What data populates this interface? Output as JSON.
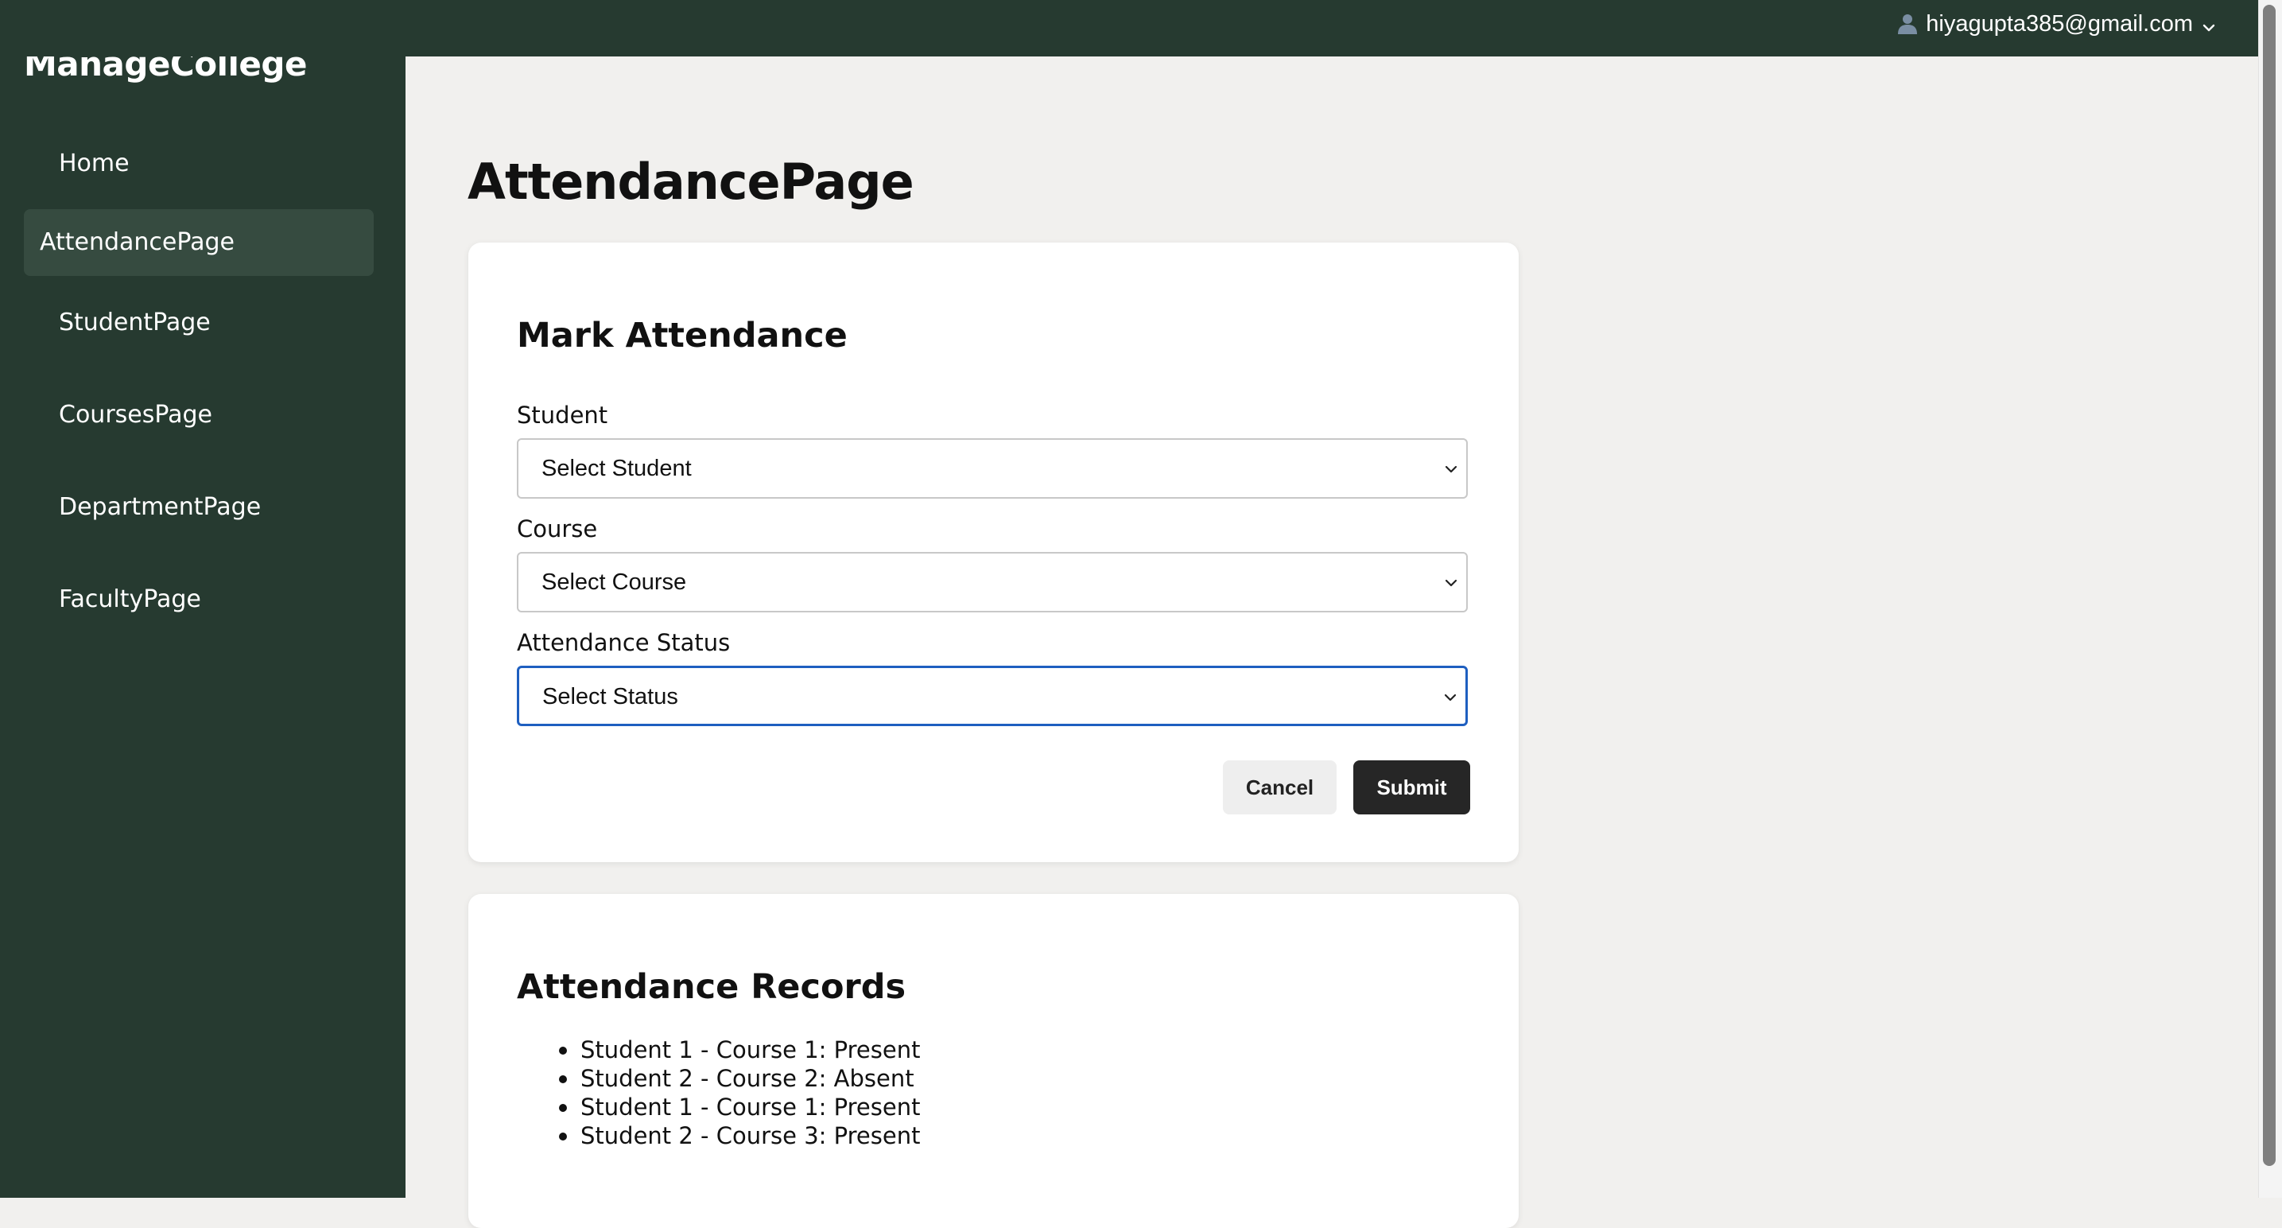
{
  "app": {
    "brand": "ManageCollege",
    "user_email": "hiyagupta385@gmail.com"
  },
  "sidebar": {
    "items": [
      {
        "label": "Home",
        "active": false
      },
      {
        "label": "AttendancePage",
        "active": true
      },
      {
        "label": "StudentPage",
        "active": false
      },
      {
        "label": "CoursesPage",
        "active": false
      },
      {
        "label": "DepartmentPage",
        "active": false
      },
      {
        "label": "FacultyPage",
        "active": false
      }
    ]
  },
  "page": {
    "title": "AttendancePage"
  },
  "form": {
    "title": "Mark Attendance",
    "student": {
      "label": "Student",
      "value": "Select Student"
    },
    "course": {
      "label": "Course",
      "value": "Select Course"
    },
    "status": {
      "label": "Attendance Status",
      "value": "Select Status",
      "focused": true
    },
    "cancel_label": "Cancel",
    "submit_label": "Submit"
  },
  "records": {
    "title": "Attendance Records",
    "items": [
      "Student 1 - Course 1: Present",
      "Student 2 - Course 2: Absent",
      "Student 1 - Course 1: Present",
      "Student 2 - Course 3: Present"
    ]
  },
  "colors": {
    "sidebar_bg": "#263a30",
    "sidebar_active_bg": "#364b40",
    "content_bg": "#f1f0ee",
    "focus_border": "#1e5fc0",
    "submit_bg": "#262626"
  },
  "icons": {
    "user": "user-icon",
    "dropdown": "chevron-down-icon"
  }
}
